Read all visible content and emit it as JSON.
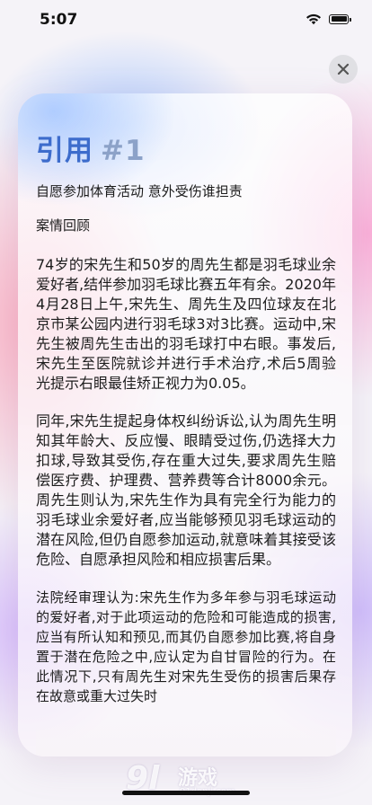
{
  "status_bar": {
    "time": "5:07"
  },
  "card": {
    "title_main": "引用",
    "title_number": "#1",
    "headline": "自愿参加体育活动 意外受伤谁担责",
    "section_title": "案情回顾",
    "paragraphs": [
      "74岁的宋先生和50岁的周先生都是羽毛球业余爱好者,结伴参加羽毛球比赛五年有余。2020年4月28日上午,宋先生、周先生及四位球友在北京市某公园内进行羽毛球3对3比赛。运动中,宋先生被周先生击出的羽毛球打中右眼。事发后,宋先生至医院就诊并进行手术治疗,术后5周验光提示右眼最佳矫正视力为0.05。",
      "同年,宋先生提起身体权纠纷诉讼,认为周先生明知其年龄大、反应慢、眼睛受过伤,仍选择大力扣球,导致其受伤,存在重大过失,要求周先生赔偿医疗费、护理费、营养费等合计8000余元。周先生则认为,宋先生作为具有完全行为能力的羽毛球业余爱好者,应当能够预见羽毛球运动的潜在风险,但仍自愿参加运动,就意味着其接受该危险、自愿承担风险和相应损害后果。",
      "法院经审理认为:宋先生作为多年参与羽毛球运动的爱好者,对于此项运动的危险和可能造成的损害,应当有所认知和预见,而其仍自愿参加比赛,将自身置于潜在危险之中,应认定为自甘冒险的行为。在此情况下,只有周先生对宋先生受伤的损害后果存在故意或重大过失时"
    ]
  },
  "watermark": {
    "logo": "9l",
    "name": "游戏",
    "url": "91danji.com"
  },
  "colors": {
    "title_accent": "#3d6ccc",
    "title_number": "#8ca2c8"
  }
}
